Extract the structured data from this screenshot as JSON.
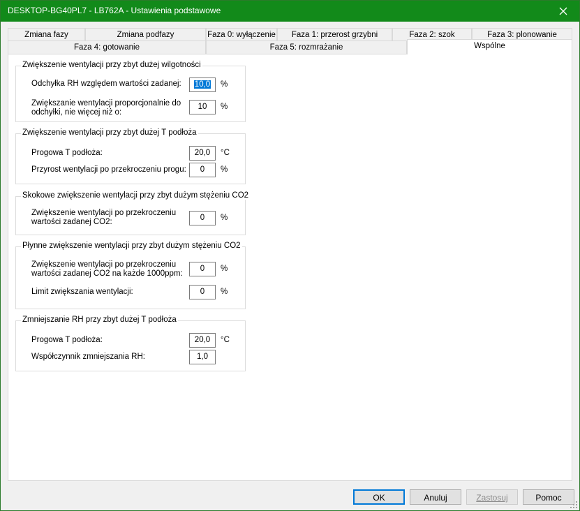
{
  "window": {
    "title": "DESKTOP-BG40PL7 - LB762A - Ustawienia podstawowe"
  },
  "tabs": {
    "row1": [
      {
        "label": "Zmiana fazy"
      },
      {
        "label": "Zmiana podfazy"
      },
      {
        "label": "Faza 0: wyłączenie"
      },
      {
        "label": "Faza 1: przerost grzybni"
      },
      {
        "label": "Faza 2: szok"
      },
      {
        "label": "Faza 3: plonowanie"
      }
    ],
    "row2": [
      {
        "label": "Faza 4: gotowanie"
      },
      {
        "label": "Faza 5: rozmrażanie"
      },
      {
        "label": "Wspólne",
        "active": true
      }
    ]
  },
  "groups": [
    {
      "title": "Zwiększenie wentylacji przy zbyt dużej wilgotności",
      "rows": [
        {
          "label": "Odchyłka RH względem wartości zadanej:",
          "value": "10,0",
          "unit": "%"
        },
        {
          "label": "Zwiększanie wentylacji proporcjonalnie do\nodchyłki, nie więcej niż o:",
          "value": "10",
          "unit": "%"
        }
      ]
    },
    {
      "title": "Zwiększenie wentylacji przy zbyt dużej T podłoża",
      "rows": [
        {
          "label": "Progowa T podłoża:",
          "value": "20,0",
          "unit": "°C"
        },
        {
          "label": "Przyrost wentylacji po przekroczeniu progu:",
          "value": "0",
          "unit": "%"
        }
      ]
    },
    {
      "title": "Skokowe zwiększenie wentylacji przy zbyt dużym stężeniu CO2",
      "rows": [
        {
          "label": "Zwiększenie wentylacji po przekroczeniu\nwartości zadanej CO2:",
          "value": "0",
          "unit": "%"
        }
      ]
    },
    {
      "title": "Płynne zwiększenie wentylacji przy zbyt dużym stężeniu CO2",
      "rows": [
        {
          "label": "Zwiększenie wentylacji po przekroczeniu\nwartości zadanej CO2 na każde 1000ppm:",
          "value": "0",
          "unit": "%"
        },
        {
          "label": "Limit zwiększania wentylacji:",
          "value": "0",
          "unit": "%"
        }
      ]
    },
    {
      "title": "Zmniejszanie RH przy zbyt dużej T podłoża",
      "rows": [
        {
          "label": "Progowa T podłoża:",
          "value": "20,0",
          "unit": "°C"
        },
        {
          "label": "Współczynnik zmniejszania RH:",
          "value": "1,0",
          "unit": ""
        }
      ]
    }
  ],
  "buttons": {
    "ok": "OK",
    "cancel": "Anuluj",
    "apply": "Zastosuj",
    "help": "Pomoc"
  },
  "colors": {
    "titlebar": "#128a1a",
    "selection": "#0078d7"
  }
}
